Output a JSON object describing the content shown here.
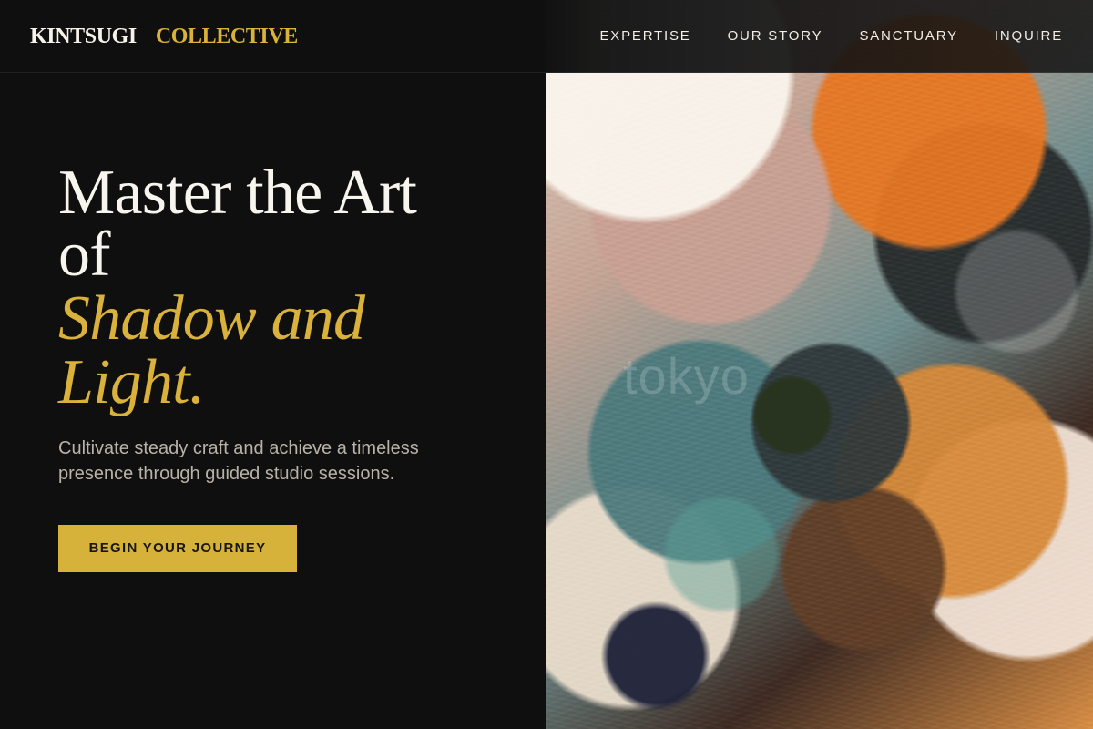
{
  "brand": {
    "primary": "KINTSUGI",
    "accent": "COLLECTIVE",
    "accent_color": "#d9b13b"
  },
  "nav": {
    "items": [
      "EXPERTISE",
      "OUR STORY",
      "SANCTUARY",
      "INQUIRE"
    ]
  },
  "hero": {
    "headline_line1": "Master the Art",
    "headline_line2": "of",
    "headline_accent_line1": "Shadow and",
    "headline_accent_line2": "Light.",
    "subtext": "Cultivate steady craft and achieve a timeless presence through guided studio sessions.",
    "cta_label": "BEGIN YOUR JOURNEY"
  },
  "art": {
    "watermark": "tokyo"
  },
  "colors": {
    "background": "#0f0f0f",
    "text_primary": "#f8f5ee",
    "text_secondary": "#b9b2a7",
    "cta_background": "#d6b23a"
  }
}
